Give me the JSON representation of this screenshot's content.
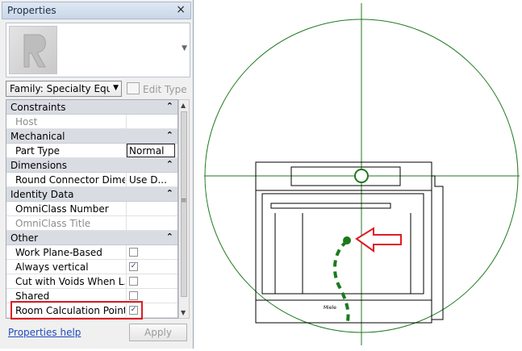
{
  "panel": {
    "title": "Properties",
    "close_glyph": "×",
    "type_selector": "Family: Specialty Equip",
    "edit_type_label": "Edit Type",
    "help_link": "Properties help",
    "apply_label": "Apply"
  },
  "groups": {
    "constraints": {
      "label": "Constraints",
      "rows": [
        {
          "name": "Host",
          "value": ""
        }
      ]
    },
    "mechanical": {
      "label": "Mechanical",
      "rows": [
        {
          "name": "Part Type",
          "value": "Normal"
        }
      ]
    },
    "dimensions": {
      "label": "Dimensions",
      "rows": [
        {
          "name": "Round Connector Dime...",
          "value": "Use D..."
        }
      ]
    },
    "identity": {
      "label": "Identity Data",
      "rows": [
        {
          "name": "OmniClass Number",
          "value": ""
        },
        {
          "name": "OmniClass Title",
          "value": ""
        }
      ]
    },
    "other": {
      "label": "Other",
      "rows": [
        {
          "name": "Work Plane-Based",
          "checked": false
        },
        {
          "name": "Always vertical",
          "checked": true
        },
        {
          "name": "Cut with Voids When L...",
          "checked": false
        },
        {
          "name": "Shared",
          "checked": false
        },
        {
          "name": "Room Calculation Point",
          "checked": true
        }
      ]
    }
  },
  "canvas": {
    "brand_text": "Miele",
    "colors": {
      "reference_lines": "#1f7a1f",
      "path": "#1b7a1b",
      "arrow": "#e01b24",
      "outline": "#000000"
    }
  }
}
